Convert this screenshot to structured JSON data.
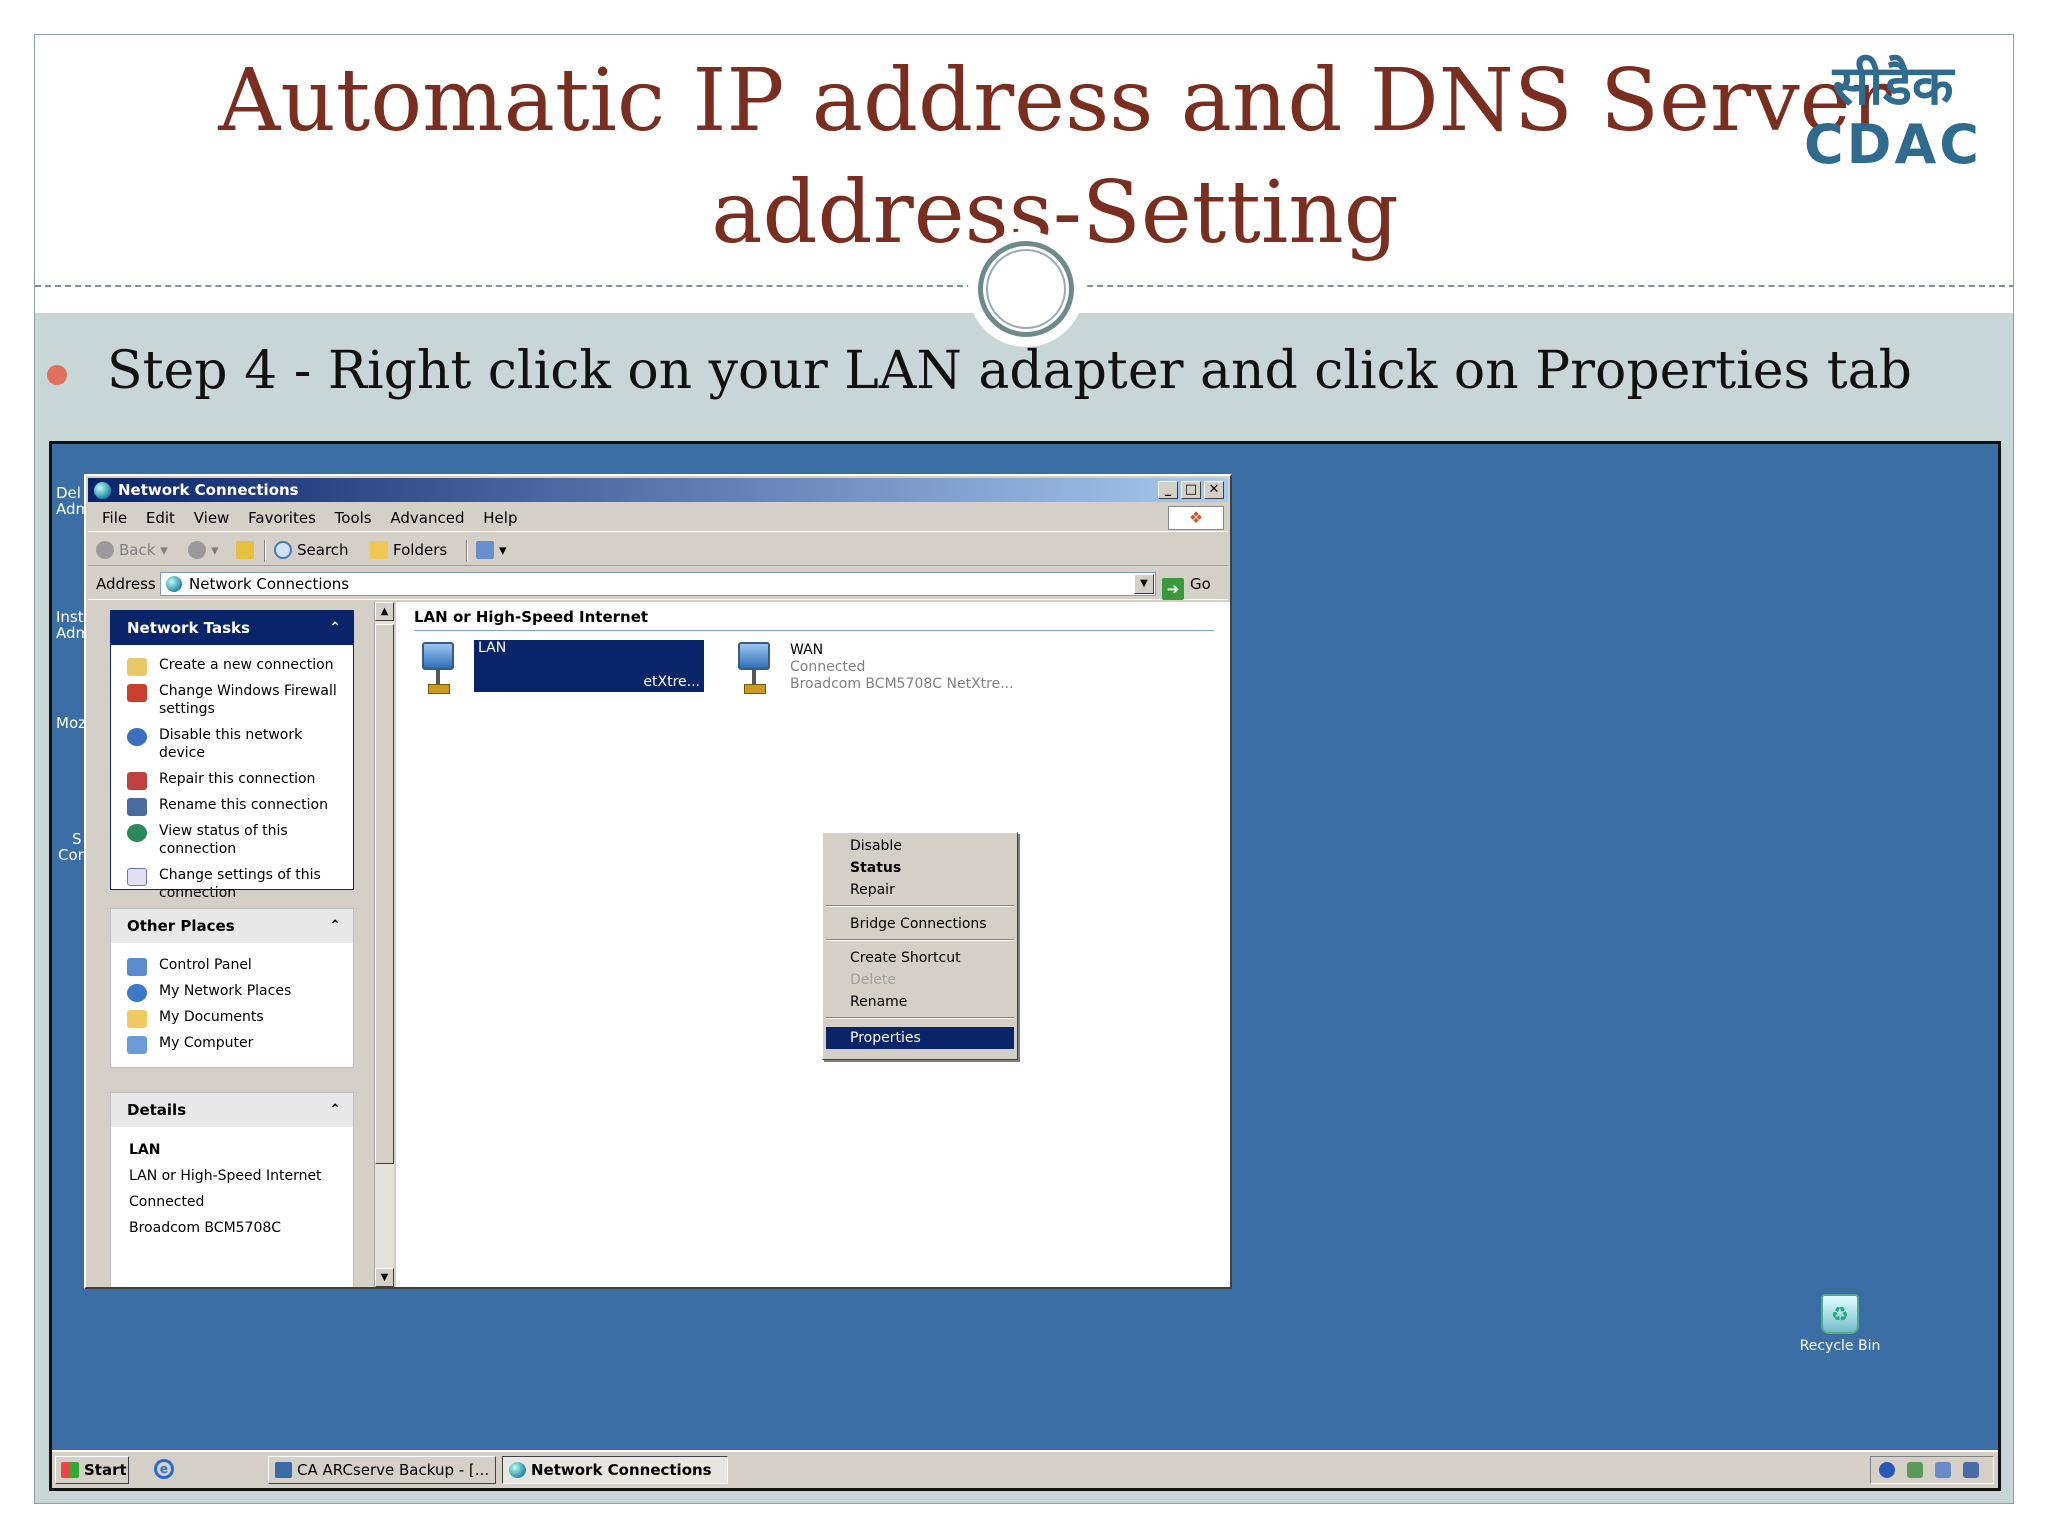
{
  "slide": {
    "title_line1": "Automatic IP address and DNS Server",
    "title_line2": "address-Setting",
    "logo_hindi": "सीडैक",
    "logo_text": "CDAC",
    "bullet": "Step 4 - Right click on your LAN adapter and click on Properties tab"
  },
  "desktop": {
    "left_fragments": [
      "Del",
      "Adm",
      "Inst",
      "Adm",
      "Moz",
      "S",
      "Cor"
    ],
    "recycle_bin": "Recycle Bin"
  },
  "window": {
    "title": "Network Connections",
    "controls": [
      "_",
      "□",
      "✕"
    ],
    "menu": [
      "File",
      "Edit",
      "View",
      "Favorites",
      "Tools",
      "Advanced",
      "Help"
    ],
    "toolbar": {
      "back": "Back",
      "search": "Search",
      "folders": "Folders"
    },
    "address": {
      "label": "Address",
      "value": "Network Connections",
      "go": "Go"
    }
  },
  "task_pane": {
    "network_tasks": {
      "title": "Network Tasks",
      "items": [
        "Create a new connection",
        "Change Windows Firewall settings",
        "Disable this network device",
        "Repair this connection",
        "Rename this connection",
        "View status of this connection",
        "Change settings of this connection"
      ]
    },
    "other_places": {
      "title": "Other Places",
      "items": [
        "Control Panel",
        "My Network Places",
        "My Documents",
        "My Computer"
      ]
    },
    "details": {
      "title": "Details",
      "name": "LAN",
      "lines": [
        "LAN or High-Speed Internet",
        "Connected",
        "Broadcom BCM5708C"
      ]
    }
  },
  "content": {
    "group": "LAN or High-Speed Internet",
    "lan": {
      "name": "LAN",
      "device_fragment": "etXtre..."
    },
    "wan": {
      "name": "WAN",
      "status": "Connected",
      "device": "Broadcom BCM5708C NetXtre..."
    }
  },
  "context_menu": {
    "items": [
      "Disable",
      "Status",
      "Repair",
      "Bridge Connections",
      "Create Shortcut",
      "Delete",
      "Rename",
      "Properties"
    ],
    "bold_item": "Status",
    "disabled_item": "Delete",
    "highlighted_item": "Properties"
  },
  "taskbar": {
    "start": "Start",
    "tasks": [
      "CA ARCserve Backup - [...",
      "Network Connections"
    ]
  },
  "colors": {
    "title": "#7a2e1f",
    "slide_body": "#c9d6d8",
    "desktop": "#3a6ea5",
    "selection": "#0a246a",
    "bullet": "#e0705a"
  }
}
